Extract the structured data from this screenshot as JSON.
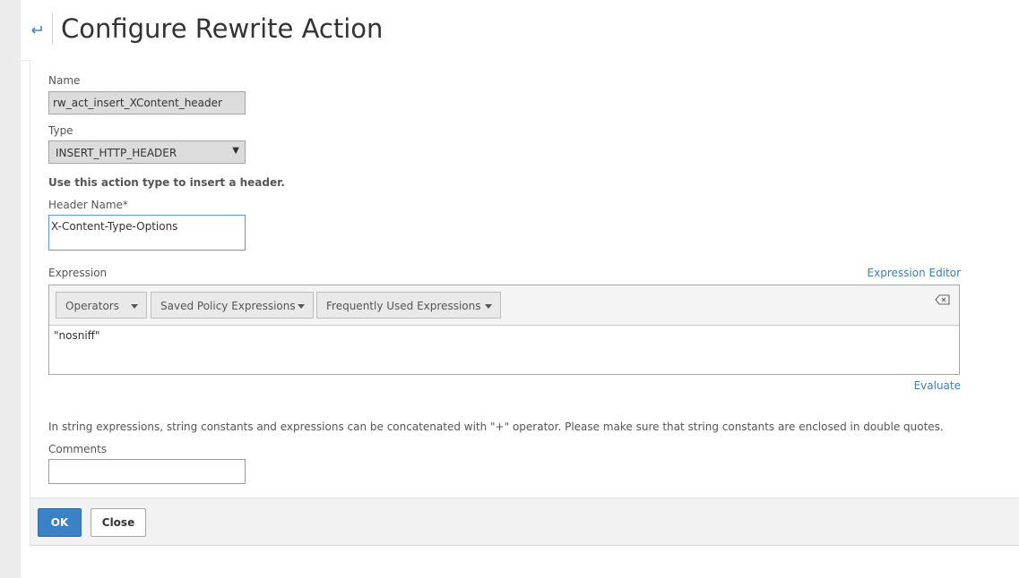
{
  "header": {
    "title": "Configure Rewrite Action",
    "back_icon": "back-arrow-icon"
  },
  "form": {
    "name_label": "Name",
    "name_value": "rw_act_insert_XContent_header",
    "type_label": "Type",
    "type_value": "INSERT_HTTP_HEADER",
    "type_hint": "Use this action type to insert a header.",
    "header_name_label": "Header Name*",
    "header_name_value": "X-Content-Type-Options",
    "expression_label": "Expression",
    "expression_editor_link": "Expression Editor",
    "toolbar": {
      "operators": "Operators",
      "saved": "Saved Policy Expressions",
      "frequent": "Frequently Used Expressions"
    },
    "expression_value": "\"nosniff\"",
    "evaluate_link": "Evaluate",
    "note": "In string expressions, string constants and expressions can be concatenated with \"+\" operator. Please make sure that string constants are enclosed in double quotes.",
    "comments_label": "Comments",
    "comments_value": ""
  },
  "footer": {
    "ok": "OK",
    "close": "Close"
  },
  "colors": {
    "primary": "#3a82c5",
    "link": "#3b7fbf"
  }
}
